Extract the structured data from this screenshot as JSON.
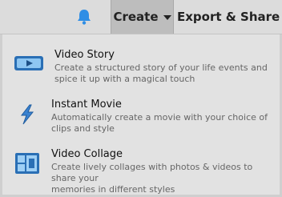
{
  "header": {
    "notifications_icon": "bell-icon",
    "create_label": "Create",
    "export_label": "Export & Share",
    "accent_color": "#2f8ee5"
  },
  "menu": {
    "items": [
      {
        "title": "Video Story",
        "desc_line1": "Create a structured story of your life events and",
        "desc_line2": "spice it up with a magical touch",
        "icon": "video-story-icon"
      },
      {
        "title": "Instant Movie",
        "desc_line1": "Automatically create a movie with your choice of",
        "desc_line2": "clips and style",
        "icon": "lightning-icon"
      },
      {
        "title": "Video Collage",
        "desc_line1": "Create lively collages with photos & videos to share your",
        "desc_line2": "memories in different styles",
        "icon": "collage-icon"
      }
    ]
  }
}
